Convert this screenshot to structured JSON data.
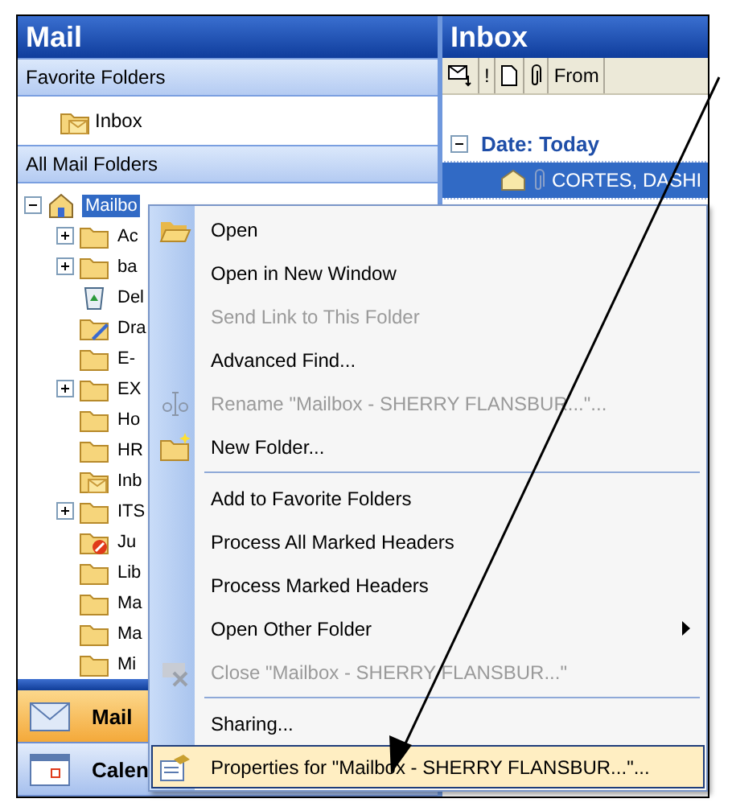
{
  "mail_pane": {
    "title": "Mail",
    "favorites_header": "Favorite Folders",
    "favorites": [
      {
        "label": "Inbox",
        "kind": "inbox"
      }
    ],
    "all_header": "All Mail Folders",
    "tree": [
      {
        "label": "Mailbo",
        "kind": "mailbox",
        "expandable": true,
        "expanded": true,
        "selected": true,
        "children": [
          {
            "label": "Ac",
            "kind": "folder",
            "expandable": true,
            "expanded": false,
            "selected": false
          },
          {
            "label": "ba",
            "kind": "folder",
            "expandable": true,
            "expanded": false,
            "selected": false
          },
          {
            "label": "Del",
            "kind": "deleted",
            "expandable": false,
            "expanded": false,
            "selected": false
          },
          {
            "label": "Dra",
            "kind": "drafts",
            "expandable": false,
            "expanded": false,
            "selected": false
          },
          {
            "label": "E-",
            "kind": "folder",
            "expandable": false,
            "expanded": false,
            "selected": false
          },
          {
            "label": "EX",
            "kind": "folder",
            "expandable": true,
            "expanded": false,
            "selected": false
          },
          {
            "label": "Ho",
            "kind": "folder",
            "expandable": false,
            "expanded": false,
            "selected": false
          },
          {
            "label": "HR",
            "kind": "folder",
            "expandable": false,
            "expanded": false,
            "selected": false
          },
          {
            "label": "Inb",
            "kind": "inbox",
            "expandable": false,
            "expanded": false,
            "selected": false
          },
          {
            "label": "ITS",
            "kind": "folder",
            "expandable": true,
            "expanded": false,
            "selected": false
          },
          {
            "label": "Ju",
            "kind": "junk",
            "expandable": false,
            "expanded": false,
            "selected": false
          },
          {
            "label": "Lib",
            "kind": "folder",
            "expandable": false,
            "expanded": false,
            "selected": false
          },
          {
            "label": "Ma",
            "kind": "folder",
            "expandable": false,
            "expanded": false,
            "selected": false
          },
          {
            "label": "Ma",
            "kind": "folder",
            "expandable": false,
            "expanded": false,
            "selected": false
          },
          {
            "label": "Mi",
            "kind": "folder",
            "expandable": false,
            "expanded": false,
            "selected": false
          }
        ]
      }
    ],
    "nav_buttons": [
      {
        "label": "Mail",
        "kind": "mail",
        "selected": true
      },
      {
        "label": "Calen",
        "kind": "calendar",
        "selected": false
      }
    ]
  },
  "inbox_pane": {
    "title": "Inbox",
    "columns": [
      {
        "kind": "icon-envelope"
      },
      {
        "kind": "text",
        "label": "!"
      },
      {
        "kind": "icon-page"
      },
      {
        "kind": "icon-clip"
      },
      {
        "kind": "text",
        "label": "From"
      }
    ],
    "group": {
      "label": "Date: Today",
      "expanded": true
    },
    "rows": [
      {
        "from": "CORTES, DASHI",
        "selected": true
      }
    ]
  },
  "context_menu": [
    {
      "kind": "open",
      "label": "Open",
      "disabled": false,
      "selected": false
    },
    {
      "kind": "plain",
      "label": "Open in New Window",
      "disabled": false,
      "selected": false
    },
    {
      "kind": "plain",
      "label": "Send Link to This Folder",
      "disabled": true,
      "selected": false
    },
    {
      "kind": "plain",
      "label": "Advanced Find...",
      "disabled": false,
      "selected": false
    },
    {
      "kind": "rename",
      "label": "Rename \"Mailbox - SHERRY FLANSBUR...\"...",
      "disabled": true,
      "selected": false
    },
    {
      "kind": "new-folder",
      "label": "New Folder...",
      "disabled": false,
      "selected": false
    },
    {
      "kind": "separator"
    },
    {
      "kind": "plain",
      "label": "Add to Favorite Folders",
      "disabled": false,
      "selected": false
    },
    {
      "kind": "plain",
      "label": "Process All Marked Headers",
      "disabled": false,
      "selected": false
    },
    {
      "kind": "plain",
      "label": "Process Marked Headers",
      "disabled": false,
      "selected": false
    },
    {
      "kind": "submenu",
      "label": "Open Other Folder",
      "disabled": false,
      "selected": false
    },
    {
      "kind": "close",
      "label": "Close \"Mailbox - SHERRY FLANSBUR...\"",
      "disabled": true,
      "selected": false
    },
    {
      "kind": "separator"
    },
    {
      "kind": "plain",
      "label": "Sharing...",
      "disabled": false,
      "selected": false
    },
    {
      "kind": "properties",
      "label": "Properties for \"Mailbox - SHERRY FLANSBUR...\"...",
      "disabled": false,
      "selected": true
    }
  ]
}
